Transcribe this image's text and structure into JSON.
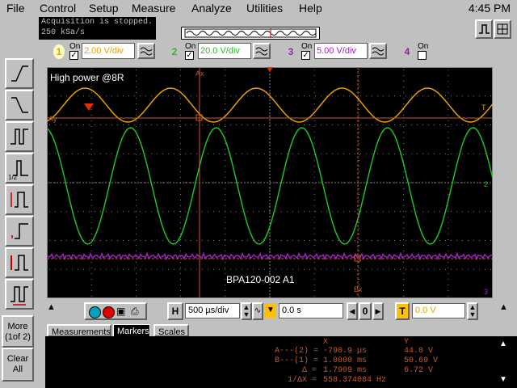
{
  "menu": {
    "items": [
      "File",
      "Control",
      "Setup",
      "Measure",
      "Analyze",
      "Utilities",
      "Help"
    ],
    "clock": "4:45 PM"
  },
  "status": {
    "line1": "Acquisition is stopped.",
    "line2": "250 kSa/s"
  },
  "channels": [
    {
      "num": "1",
      "on_label": "On",
      "value": "2.00 V/div",
      "color": "#e8a000"
    },
    {
      "num": "2",
      "on_label": "On",
      "value": "20.0 V/div",
      "color": "#20c020"
    },
    {
      "num": "3",
      "on_label": "On",
      "value": "5.00 V/div",
      "color": "#a020c0"
    },
    {
      "num": "4",
      "on_label": "On",
      "value": "",
      "color": "#c000c0"
    }
  ],
  "plot": {
    "label": "High power @8R",
    "footer_label": "BPA120-002 A1",
    "marker_a": "Ax",
    "marker_b": "Bx",
    "marker_ay": "Ay",
    "marker_by": "By",
    "ch1_marker": "1",
    "trig": "T",
    "ch2_marker": "2",
    "ch3_marker": "3"
  },
  "timebase": {
    "h_label": "H",
    "value": "500 µs/div",
    "delay": "0.0 s",
    "delay_btn": "0",
    "trig_label": "T",
    "trig_value": "0.0 V"
  },
  "tabs": [
    "Measurements",
    "Markers",
    "Scales"
  ],
  "markers": {
    "x_header": "X",
    "y_header": "Y",
    "rows": [
      {
        "label": "A---(2) =",
        "x": "-790.9 µs",
        "y": "44.0 V"
      },
      {
        "label": "B---(1) =",
        "x": "1.0000 ms",
        "y": "50.69 V"
      },
      {
        "label": "Δ =",
        "x": "1.7909 ms",
        "y": "6.72 V"
      },
      {
        "label": "1/ΔX =",
        "x": "558.374084 Hz",
        "y": ""
      }
    ]
  },
  "side": {
    "more": "More",
    "more2": "(1of 2)",
    "clear": "Clear",
    "all": "All"
  }
}
